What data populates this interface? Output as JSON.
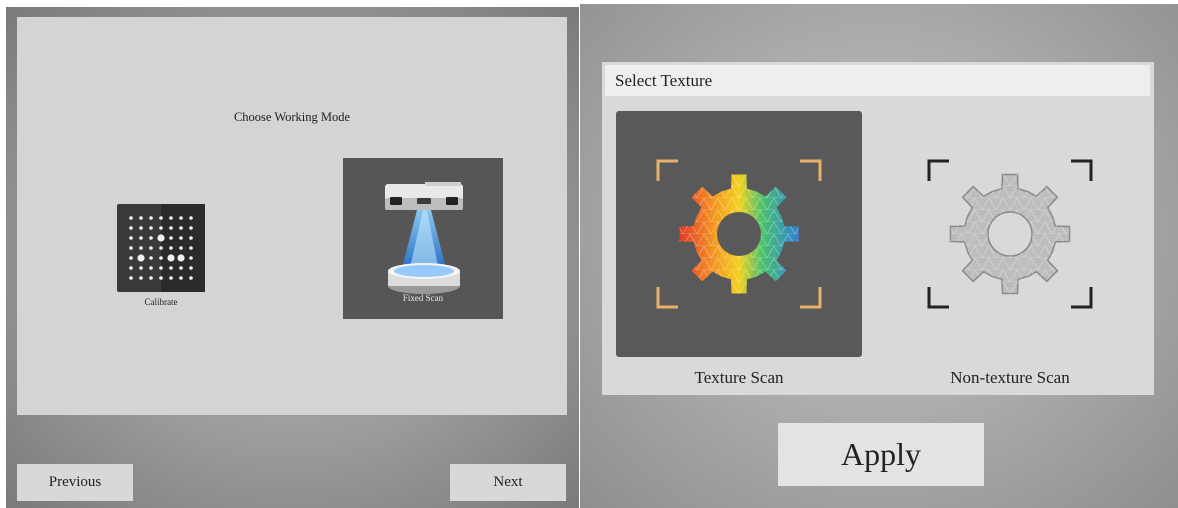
{
  "working_mode": {
    "title": "Choose Working Mode",
    "options": [
      {
        "label": "Calibrate",
        "icon": "calibration-board-icon",
        "selected": false
      },
      {
        "label": "Fixed Scan",
        "icon": "fixed-scanner-icon",
        "selected": true
      }
    ],
    "previous_label": "Previous",
    "next_label": "Next"
  },
  "texture": {
    "header": "Select Texture",
    "options": [
      {
        "label": "Texture Scan",
        "icon": "color-gear-icon",
        "selected": true
      },
      {
        "label": "Non-texture Scan",
        "icon": "gray-gear-icon",
        "selected": false
      }
    ],
    "apply_label": "Apply"
  },
  "colors": {
    "selected_tile": "#565656",
    "card": "#d4d4d4",
    "button": "#d8d8d8",
    "corner_accent": "#e8b16a"
  }
}
